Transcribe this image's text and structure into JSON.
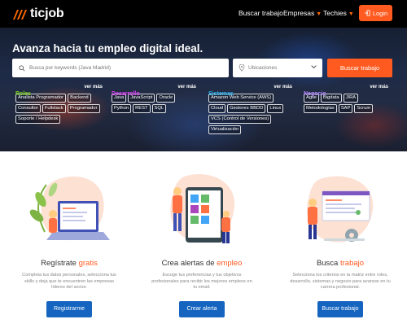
{
  "header": {
    "logo_text": "ticjob",
    "nav": [
      {
        "label": "Buscar trabajo",
        "has_caret": false
      },
      {
        "label": "Empresas",
        "has_caret": true
      },
      {
        "label": "Techies",
        "has_caret": true
      }
    ],
    "login_label": "Login"
  },
  "hero": {
    "title": "Avanza hacia tu empleo digital ideal.",
    "search_placeholder": "Busca por keywords (Java Madrid)",
    "location_placeholder": "Ubicaciones",
    "search_button": "Buscar trabajo",
    "categories": [
      {
        "title": "Roles",
        "color": "#7ed321",
        "more": "ver más",
        "tags": [
          "Analista Programador",
          "Backend",
          "Consultor",
          "Fullstack",
          "Programador",
          "Soporte / Helpdesk"
        ]
      },
      {
        "title": "Desarrollo",
        "color": "#e040fb",
        "more": "ver más",
        "tags": [
          "Java",
          "JavaScript",
          "Oracle",
          "Python",
          "REST",
          "SQL"
        ]
      },
      {
        "title": "Sistemas",
        "color": "#29b6f6",
        "more": "ver más",
        "tags": [
          "Amazon Web Service (AWS)",
          "Cloud",
          "Gestores BBDD",
          "Linux",
          "VCS (Control de Versiones)",
          "Virtualización"
        ]
      },
      {
        "title": "Negocio",
        "color": "#b388ff",
        "more": "ver más",
        "tags": [
          "Agile",
          "Bigdata",
          "JIRA",
          "Metodologías",
          "SAP",
          "Scrum"
        ]
      }
    ]
  },
  "features": [
    {
      "title_main": "Regístrate ",
      "title_highlight": "gratis",
      "desc": "Completa tus datos personales, selecciona tus skills y deja que te encuentren las empresas líderes del sector.",
      "button": "Registrarme",
      "icon": "laptop-illustration"
    },
    {
      "title_main": "Crea alertas de ",
      "title_highlight": "empleo",
      "desc": "Escoge tus preferencias y tus objetivos profesionales para recibir los mejores empleos en tu email.",
      "button": "Crear alerta",
      "icon": "tablet-illustration"
    },
    {
      "title_main": "Busca ",
      "title_highlight": "trabajo",
      "desc": "Selecciona los criterios en la matriz entre roles, desarrollo, sistemas y negocio para avanzar en tu carrera profesional.",
      "button": "Buscar trabajo",
      "icon": "window-gear-illustration"
    }
  ],
  "colors": {
    "accent": "#ff5a1f",
    "primary_button": "#1565c0",
    "header_bg": "#000000"
  }
}
